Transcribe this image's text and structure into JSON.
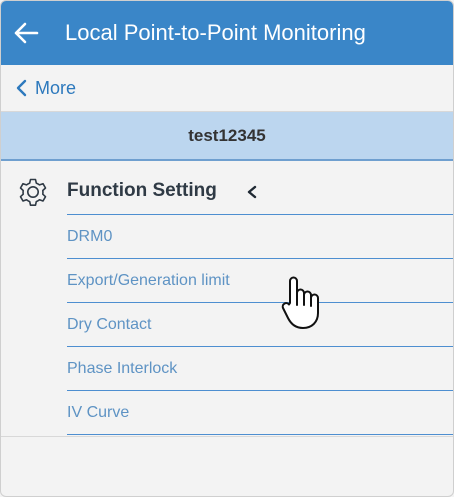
{
  "header": {
    "title": "Local Point-to-Point Monitoring",
    "back_icon": "arrow-left-icon",
    "background": "#3a86c8"
  },
  "nav": {
    "more_label": "More",
    "icon": "chevron-left-icon",
    "link_color": "#2d79bd"
  },
  "device": {
    "name": "test12345",
    "background": "#bcd6ef"
  },
  "section": {
    "title": "Function Setting",
    "icon": "gear-icon",
    "state_icon": "chevron-left-icon"
  },
  "menu": {
    "items": [
      {
        "label": "DRM0"
      },
      {
        "label": "Export/Generation limit"
      },
      {
        "label": "Dry Contact"
      },
      {
        "label": "Phase Interlock"
      },
      {
        "label": "IV Curve"
      }
    ],
    "text_color": "#5e93c4",
    "divider_color": "#4d8ed0"
  },
  "pointer": {
    "icon": "hand-pointer-icon"
  }
}
